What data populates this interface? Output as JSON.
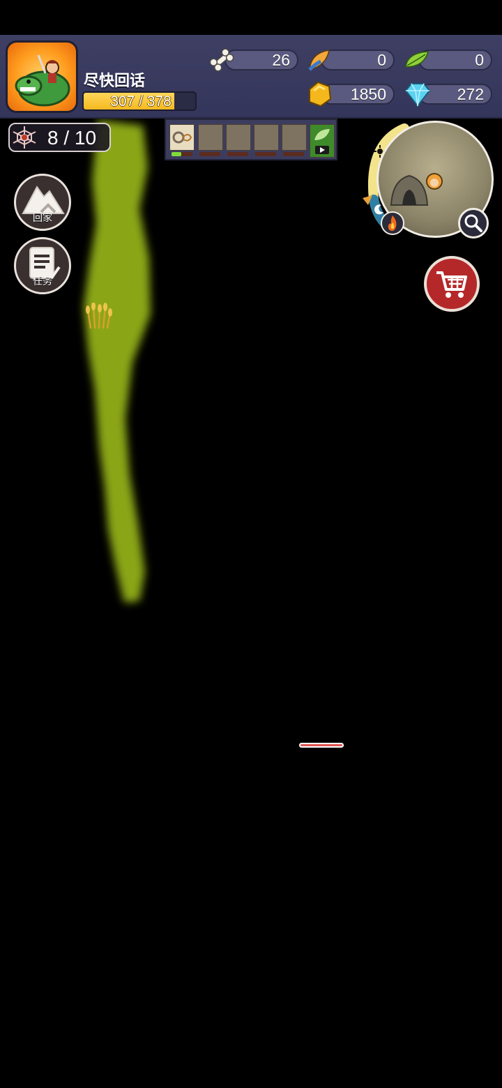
{
  "player": {
    "name": "尽快回话",
    "hp_text": "307 / 378",
    "hp_current": 307,
    "hp_max": 378
  },
  "resources": {
    "bone": "26",
    "feather": "0",
    "leaf": "0",
    "gold": "1850",
    "diamond": "272"
  },
  "web_counter": "8 / 10",
  "buttons": {
    "home_label": "回家",
    "task_label": "任务"
  },
  "colors": {
    "hud_bg": "#3e3f63",
    "hp_fill": "#f5b920",
    "terrain_green": "#8faa1c",
    "cart_red": "#b5282a"
  },
  "icons": [
    "bone-icon",
    "feather-icon",
    "leaf-icon",
    "gold-nugget-icon",
    "diamond-icon",
    "spider-web-icon",
    "mountain-home-icon",
    "task-list-icon",
    "cart-icon",
    "magnifier-icon",
    "fire-icon",
    "sun-icon",
    "moon-icon"
  ]
}
